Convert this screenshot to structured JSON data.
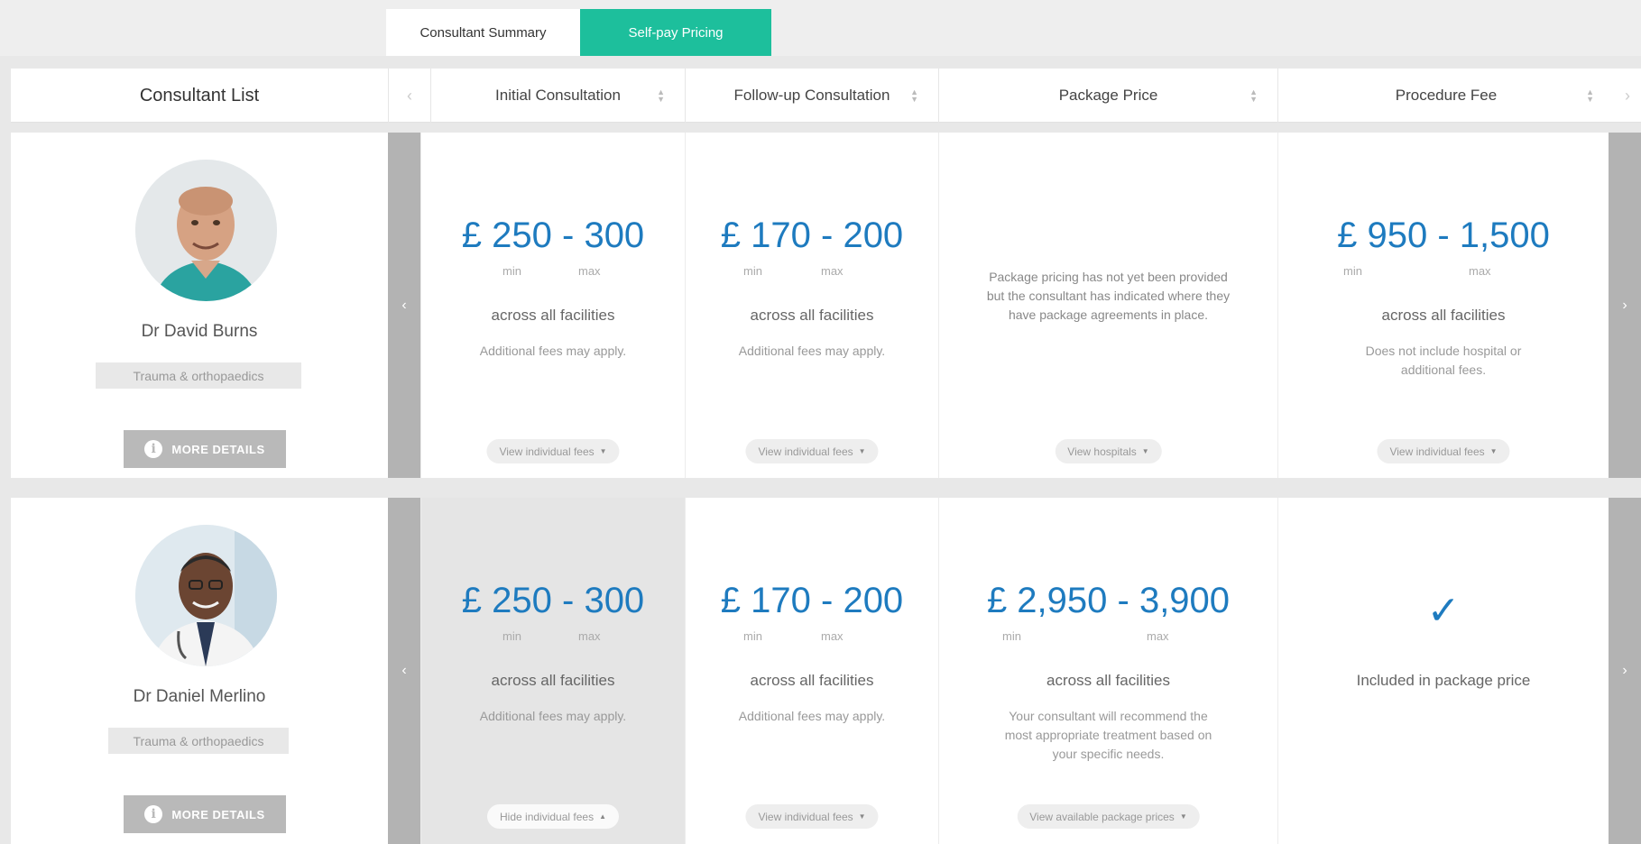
{
  "tabs": {
    "summary": "Consultant Summary",
    "selfpay": "Self-pay Pricing"
  },
  "header": {
    "list_title": "Consultant List",
    "prev": "‹",
    "next": "›",
    "columns": [
      "Initial Consultation",
      "Follow-up Consultation",
      "Package Price",
      "Procedure Fee"
    ],
    "sort_up": "▲",
    "sort_down": "▼"
  },
  "common": {
    "min": "min",
    "max": "max",
    "across": "across all facilities",
    "additional": "Additional fees may apply.",
    "more_details": "MORE DETAILS",
    "info": "i",
    "caret_down": "▼",
    "caret_up": "▲",
    "arrow_left": "‹",
    "arrow_right": "›"
  },
  "consultants": [
    {
      "name": "Dr David Burns",
      "specialty": "Trauma & orthopaedics",
      "initial": {
        "price": "£ 250 - 300",
        "pill": "View individual fees"
      },
      "follow": {
        "price": "£ 170 - 200",
        "pill": "View individual fees"
      },
      "package": {
        "note": "Package pricing has not yet been provided but the consultant has indicated where they have package agreements in place.",
        "pill": "View hospitals"
      },
      "procedure": {
        "price": "£ 950 - 1,500",
        "note": "Does not include hospital or additional fees.",
        "pill": "View individual fees"
      }
    },
    {
      "name": "Dr Daniel Merlino",
      "specialty": "Trauma & orthopaedics",
      "initial": {
        "price": "£ 250 - 300",
        "pill": "Hide individual fees"
      },
      "follow": {
        "price": "£ 170 - 200",
        "pill": "View individual fees"
      },
      "package": {
        "price": "£ 2,950 - 3,900",
        "note": "Your consultant will recommend the most appropriate treatment based on your specific needs.",
        "pill": "View available package prices"
      },
      "procedure": {
        "check": "✓",
        "included": "Included in package price"
      }
    }
  ],
  "colors": {
    "accent": "#1dbf9c",
    "price_blue": "#1e7bbf",
    "arrow_gray": "#b3b3b3"
  }
}
